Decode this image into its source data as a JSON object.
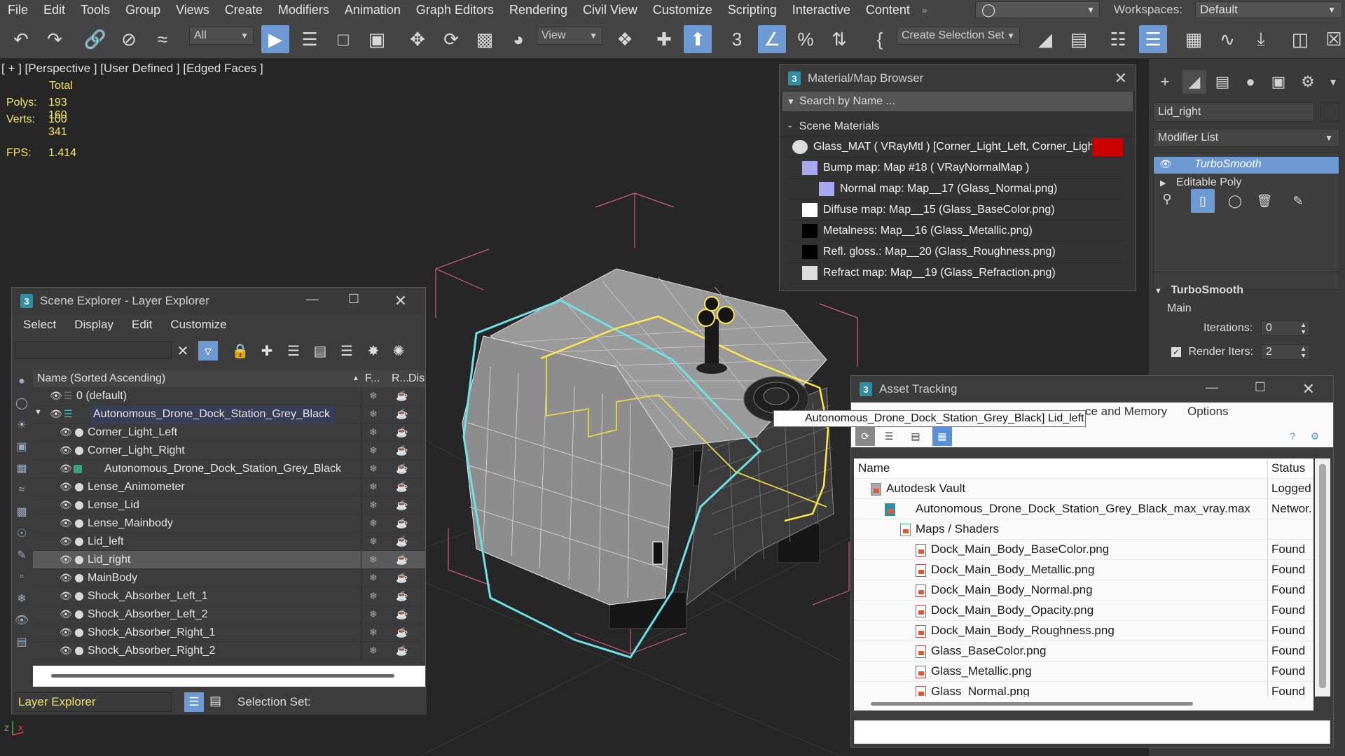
{
  "menu": [
    "File",
    "Edit",
    "Tools",
    "Group",
    "Views",
    "Create",
    "Modifiers",
    "Animation",
    "Graph Editors",
    "Rendering",
    "Civil View",
    "Customize",
    "Scripting",
    "Interactive",
    "Content"
  ],
  "workspaces_label": "Workspaces:",
  "workspace_value": "Default",
  "toolbar": {
    "filter_value": "All",
    "refcoord_value": "View",
    "selection_set_placeholder": "Create Selection Set",
    "snap_label": "3"
  },
  "viewport": {
    "label": "[ + ] [Perspective ]  [User Defined ]  [Edged Faces ]",
    "total_label": "Total",
    "polys_label": "Polys:",
    "polys_value": "193 160",
    "verts_label": "Verts:",
    "verts_value": "100 341",
    "fps_label": "FPS:",
    "fps_value": "1.414"
  },
  "material_browser": {
    "title": "Material/Map Browser",
    "search_placeholder": "Search by Name ...",
    "section": "Scene Materials",
    "rows": [
      {
        "text": "Glass_MAT  ( VRayMtl )  [Corner_Light_Left, Corner_Light...",
        "color": "#dddddd"
      },
      {
        "text": "Bump map: Map #18  ( VRayNormalMap )",
        "color": "#a9a6f2"
      },
      {
        "text": "Normal map: Map__17 (Glass_Normal.png)",
        "color": "#a9a6f2"
      },
      {
        "text": "Diffuse map: Map__15 (Glass_BaseColor.png)",
        "color": "#ffffff"
      },
      {
        "text": "Metalness: Map__16 (Glass_Metallic.png)",
        "color": "#000000"
      },
      {
        "text": "Refl. gloss.: Map__20 (Glass_Roughness.png)",
        "color": "#000000"
      },
      {
        "text": "Refract map: Map__19 (Glass_Refraction.png)",
        "color": "#dddddd"
      }
    ]
  },
  "scene_explorer": {
    "title": "Scene Explorer - Layer Explorer",
    "menu": [
      "Select",
      "Display",
      "Edit",
      "Customize"
    ],
    "col_name": "Name (Sorted Ascending)",
    "col_f": "F...",
    "col_r": "R...",
    "col_dis": "Dis",
    "rows": [
      {
        "name": "0 (default)",
        "indent": 0,
        "type": "layer"
      },
      {
        "name": "Autonomous_Drone_Dock_Station_Grey_Black",
        "indent": 0,
        "type": "layer-open"
      },
      {
        "name": "Corner_Light_Left",
        "indent": 1,
        "type": "obj"
      },
      {
        "name": "Corner_Light_Right",
        "indent": 1,
        "type": "obj"
      },
      {
        "name": "Autonomous_Drone_Dock_Station_Grey_Black",
        "indent": 1,
        "type": "group"
      },
      {
        "name": "Lense_Animometer",
        "indent": 1,
        "type": "obj"
      },
      {
        "name": "Lense_Lid",
        "indent": 1,
        "type": "obj"
      },
      {
        "name": "Lense_Mainbody",
        "indent": 1,
        "type": "obj"
      },
      {
        "name": "Lid_left",
        "indent": 1,
        "type": "obj"
      },
      {
        "name": "Lid_right",
        "indent": 1,
        "type": "obj"
      },
      {
        "name": "MainBody",
        "indent": 1,
        "type": "obj"
      },
      {
        "name": "Shock_Absorber_Left_1",
        "indent": 1,
        "type": "obj"
      },
      {
        "name": "Shock_Absorber_Left_2",
        "indent": 1,
        "type": "obj"
      },
      {
        "name": "Shock_Absorber_Right_1",
        "indent": 1,
        "type": "obj"
      },
      {
        "name": "Shock_Absorber_Right_2",
        "indent": 1,
        "type": "obj"
      }
    ],
    "footer_dropdown": "Layer Explorer",
    "selection_set_label": "Selection Set:"
  },
  "command_panel": {
    "object_name": "Lid_right",
    "modifier_list_label": "Modifier List",
    "stack": [
      "TurboSmooth",
      "Editable Poly"
    ],
    "rollout_title": "TurboSmooth",
    "main_label": "Main",
    "iterations_label": "Iterations:",
    "iterations_value": "0",
    "render_iters_label": "Render Iters:",
    "render_iters_value": "2"
  },
  "asset_tracking": {
    "title": "Asset Tracking",
    "menu_partial": "ce and Memory",
    "menu_options": "Options",
    "col_name": "Name",
    "col_status": "Status",
    "rows": [
      {
        "name": "Autodesk Vault",
        "status": "Logged",
        "indent": 0,
        "icon": "vault"
      },
      {
        "name": "Autonomous_Drone_Dock_Station_Grey_Black_max_vray.max",
        "status": "Networ.",
        "indent": 1,
        "icon": "max"
      },
      {
        "name": "Maps / Shaders",
        "status": "",
        "indent": 2,
        "icon": "folder"
      },
      {
        "name": "Dock_Main_Body_BaseColor.png",
        "status": "Found",
        "indent": 3,
        "icon": "file"
      },
      {
        "name": "Dock_Main_Body_Metallic.png",
        "status": "Found",
        "indent": 3,
        "icon": "file"
      },
      {
        "name": "Dock_Main_Body_Normal.png",
        "status": "Found",
        "indent": 3,
        "icon": "file"
      },
      {
        "name": "Dock_Main_Body_Opacity.png",
        "status": "Found",
        "indent": 3,
        "icon": "file"
      },
      {
        "name": "Dock_Main_Body_Roughness.png",
        "status": "Found",
        "indent": 3,
        "icon": "file"
      },
      {
        "name": "Glass_BaseColor.png",
        "status": "Found",
        "indent": 3,
        "icon": "file"
      },
      {
        "name": "Glass_Metallic.png",
        "status": "Found",
        "indent": 3,
        "icon": "file"
      },
      {
        "name": "Glass_Normal.png",
        "status": "Found",
        "indent": 3,
        "icon": "file"
      }
    ]
  },
  "tooltip": "Autonomous_Drone_Dock_Station_Grey_Black] Lid_left",
  "colors": {
    "accent_blue": "#6e9ad4",
    "stats_yellow": "#f0e36b",
    "selection_cyan": "#6fe0e6",
    "selection_yellow": "#ffe84a"
  }
}
